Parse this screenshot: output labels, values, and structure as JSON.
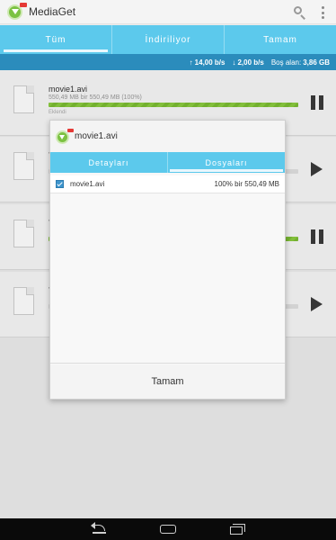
{
  "app": {
    "title": "MediaGet"
  },
  "tabs": [
    {
      "label": "Tüm"
    },
    {
      "label": "İndiriliyor"
    },
    {
      "label": "Tamam"
    }
  ],
  "status": {
    "download_speed": "14,00 b/s",
    "upload_speed": "2,00 b/s",
    "free_label": "Boş alan:",
    "free_value": "3,86 GB"
  },
  "downloads": [
    {
      "name": "movie1.avi",
      "size": "550,49 MB bir 550,49 MB (100%)",
      "status": "Eklendi",
      "progress": 1.0,
      "state": "pause",
      "bar_color": "green"
    },
    {
      "name": "T",
      "size": "",
      "status": "",
      "progress": 0.0,
      "state": "play",
      "bar_color": "blue"
    },
    {
      "name": "T",
      "size": "",
      "status": "",
      "progress": 1.0,
      "state": "pause",
      "bar_color": "green"
    },
    {
      "name": "T",
      "size": "",
      "status": "",
      "progress": 0.0,
      "state": "play",
      "bar_color": "blue"
    }
  ],
  "dialog": {
    "title": "movie1.avi",
    "tabs": [
      {
        "label": "Detayları"
      },
      {
        "label": "Dosyaları"
      }
    ],
    "active_tab": 1,
    "files": [
      {
        "name": "movie1.avi",
        "progress": "100% bir 550,49 MB",
        "checked": true
      }
    ],
    "ok_label": "Tamam"
  },
  "colors": {
    "accent": "#5cc9ec",
    "status_bar": "#2b8cbc",
    "progress_green": "#8bcb3f"
  }
}
